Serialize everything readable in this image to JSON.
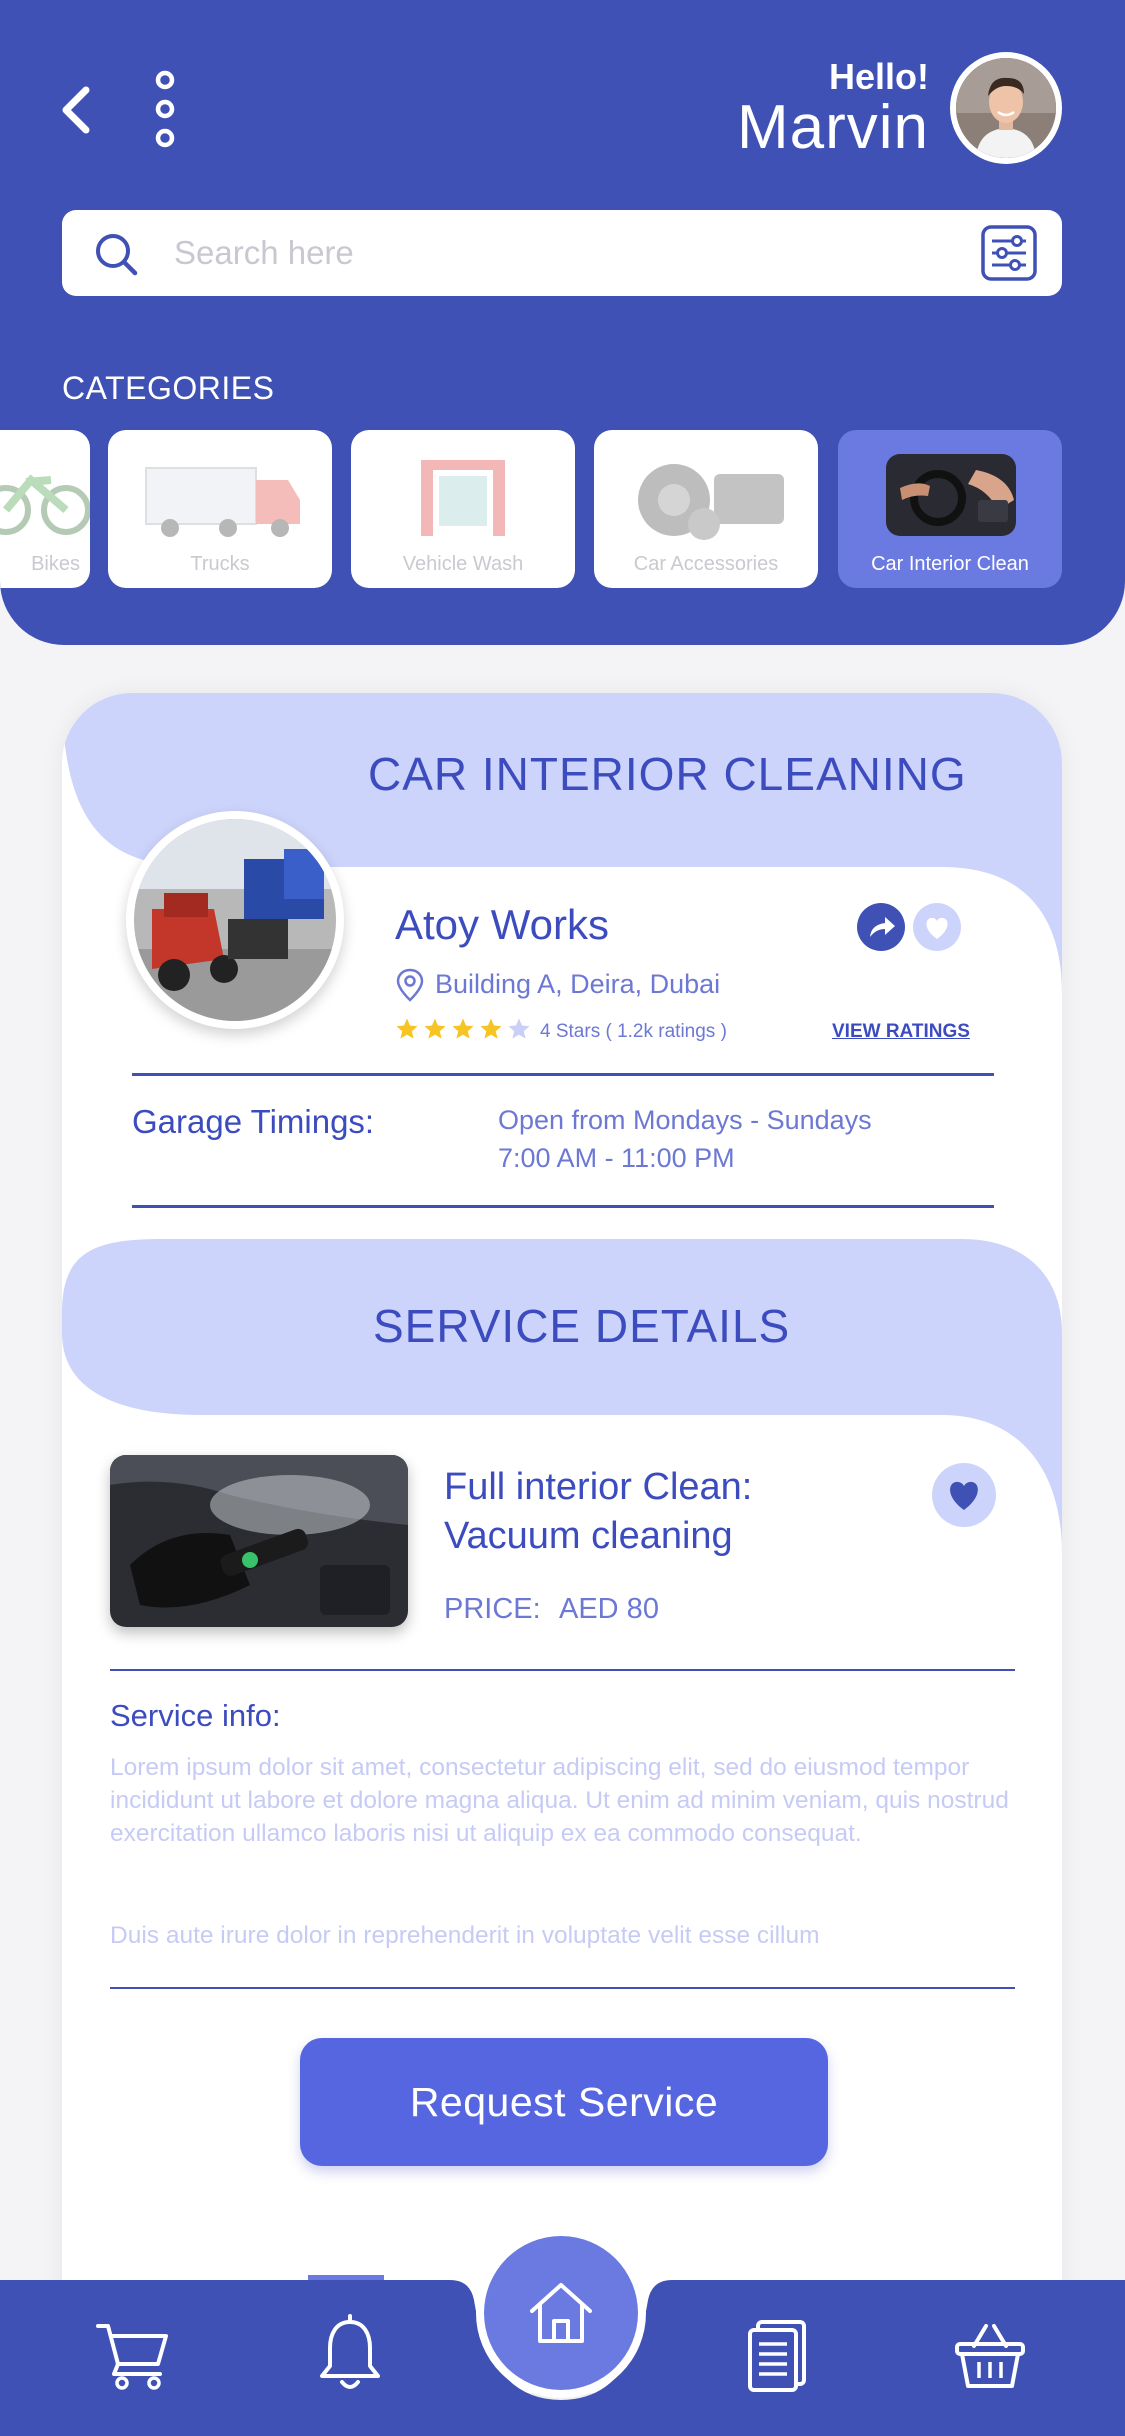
{
  "header": {
    "greeting": "Hello!",
    "user_name": "Marvin"
  },
  "search": {
    "placeholder": "Search here"
  },
  "categories": {
    "label": "CATEGORIES",
    "items": [
      {
        "label": "Bikes",
        "active": false
      },
      {
        "label": "Trucks",
        "active": false
      },
      {
        "label": "Vehicle Wash",
        "active": false
      },
      {
        "label": "Car Accessories",
        "active": false
      },
      {
        "label": "Car Interior Clean",
        "active": true
      }
    ]
  },
  "garage": {
    "section_title": "CAR INTERIOR CLEANING",
    "name": "Atoy Works",
    "location": "Building A, Deira, Dubai",
    "rating_stars": 4,
    "rating_max": 5,
    "rating_text": "4 Stars ( 1.2k ratings )",
    "view_ratings_label": "VIEW RATINGS",
    "timings_label": "Garage Timings:",
    "timings_days": "Open from Mondays - Sundays",
    "timings_hours": "7:00 AM - 11:00 PM"
  },
  "service": {
    "section_title": "SERVICE DETAILS",
    "name_line1": "Full interior Clean:",
    "name_line2": "Vacuum cleaning",
    "price_label": "PRICE:",
    "price_value": "AED 80",
    "info_label": "Service info:",
    "info_text": "Lorem ipsum dolor sit amet, consectetur adipiscing elit, sed do eiusmod tempor incididunt ut labore et dolore magna aliqua. Ut enim ad minim veniam, quis nostrud exercitation ullamco laboris nisi ut aliquip ex ea commodo consequat.",
    "info_text2": "Duis aute irure dolor in reprehenderit in voluptate velit esse cillum",
    "request_button": "Request Service"
  },
  "nav": {
    "items": [
      "cart-icon",
      "bell-icon",
      "home-icon",
      "document-icon",
      "basket-icon"
    ],
    "active": "home-icon"
  },
  "colors": {
    "primary": "#3f51b5",
    "accent": "#5566e0",
    "light": "#ccd4fb",
    "star": "#f7c425"
  }
}
